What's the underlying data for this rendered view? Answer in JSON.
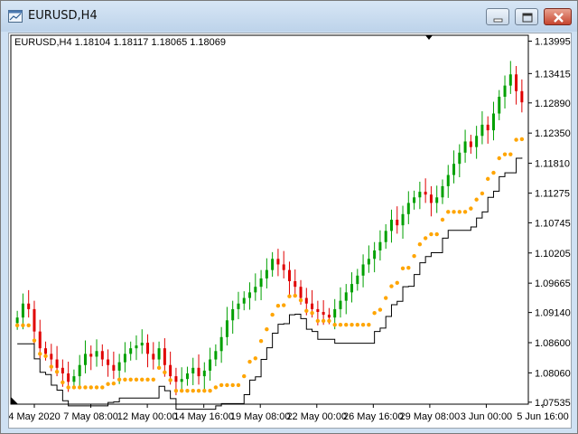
{
  "window": {
    "title": "EURUSD,H4",
    "icon": "chart-window-icon",
    "controls": [
      "minimize-icon",
      "maximize-icon",
      "close-icon"
    ]
  },
  "chart": {
    "info_line": "EURUSD,H4  1.18104 1.18117 1.18065 1.18069",
    "colors": {
      "bull": "#00a000",
      "bear": "#e00000",
      "dots": "#ffa500",
      "line": "#000000",
      "grid": "#000000"
    }
  },
  "chart_data": {
    "type": "candlestick",
    "symbol": "EURUSD",
    "timeframe": "H4",
    "ohlc_last": {
      "open": 1.18104,
      "high": 1.18117,
      "low": 1.18065,
      "close": 1.18069
    },
    "y_ticks": [
      "1.13995",
      "1.13415",
      "1.12890",
      "1.12350",
      "1.11810",
      "1.11275",
      "1.10745",
      "1.10205",
      "1.09665",
      "1.09140",
      "1.08600",
      "1.08060",
      "1.07535"
    ],
    "x_ticks": [
      "4 May 2020",
      "7 May 08:00",
      "12 May 00:00",
      "14 May 16:00",
      "19 May 08:00",
      "22 May 00:00",
      "26 May 16:00",
      "29 May 08:00",
      "3 Jun 00:00",
      "5 Jun 16:00"
    ],
    "ylim": [
      1.075,
      1.141
    ],
    "close_path": [
      1.0905,
      1.093,
      1.092,
      1.088,
      1.085,
      1.084,
      1.083,
      1.0815,
      1.0805,
      1.079,
      1.08,
      1.082,
      1.084,
      1.0835,
      1.0845,
      1.083,
      1.082,
      1.081,
      1.0825,
      1.084,
      1.085,
      1.0855,
      1.086,
      1.084,
      1.083,
      1.085,
      1.082,
      1.08,
      1.079,
      1.0795,
      1.0805,
      1.0815,
      1.08,
      1.081,
      1.083,
      1.0845,
      1.087,
      1.09,
      1.092,
      1.093,
      1.094,
      1.095,
      1.096,
      1.0975,
      1.099,
      1.101,
      1.1,
      1.099,
      1.097,
      1.096,
      1.094,
      1.093,
      1.092,
      1.0915,
      1.091,
      1.0905,
      1.092,
      1.0935,
      1.095,
      1.0965,
      1.098,
      1.1,
      1.101,
      1.1025,
      1.104,
      1.106,
      1.108,
      1.107,
      1.109,
      1.111,
      1.112,
      1.113,
      1.1125,
      1.111,
      1.112,
      1.114,
      1.116,
      1.118,
      1.12,
      1.122,
      1.121,
      1.123,
      1.125,
      1.124,
      1.127,
      1.13,
      1.132,
      1.134,
      1.131,
      1.129
    ]
  }
}
